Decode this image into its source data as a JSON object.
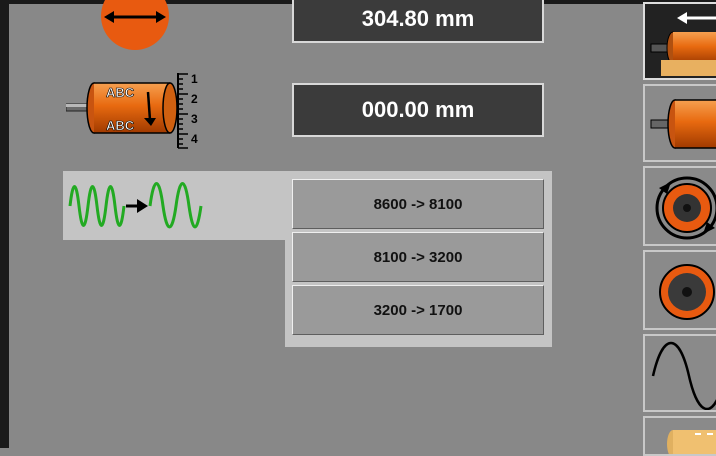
{
  "readouts": {
    "length": "304.80 mm",
    "marker": "000.00 mm"
  },
  "frequency": {
    "options": [
      "8600 -> 8100",
      "8100 -> 3200",
      "3200 -> 1700"
    ]
  },
  "roll_icon": {
    "label_top": "ABC",
    "label_bottom": "ABC",
    "ruler_numbers": [
      "1",
      "2",
      "3",
      "4"
    ]
  },
  "colors": {
    "accent_orange": "#e85a10",
    "wave_green": "#22aa22",
    "readout_bg": "#3b3b3b"
  },
  "icons": {
    "top": "direction-arrows-icon",
    "roll": "label-roll-ruler-icon",
    "frequency": "frequency-change-icon",
    "side": [
      "rewind-roll-icon",
      "roll-icon",
      "rotation-icon",
      "core-icon",
      "sine-wave-icon",
      "roll-partial-icon"
    ]
  }
}
